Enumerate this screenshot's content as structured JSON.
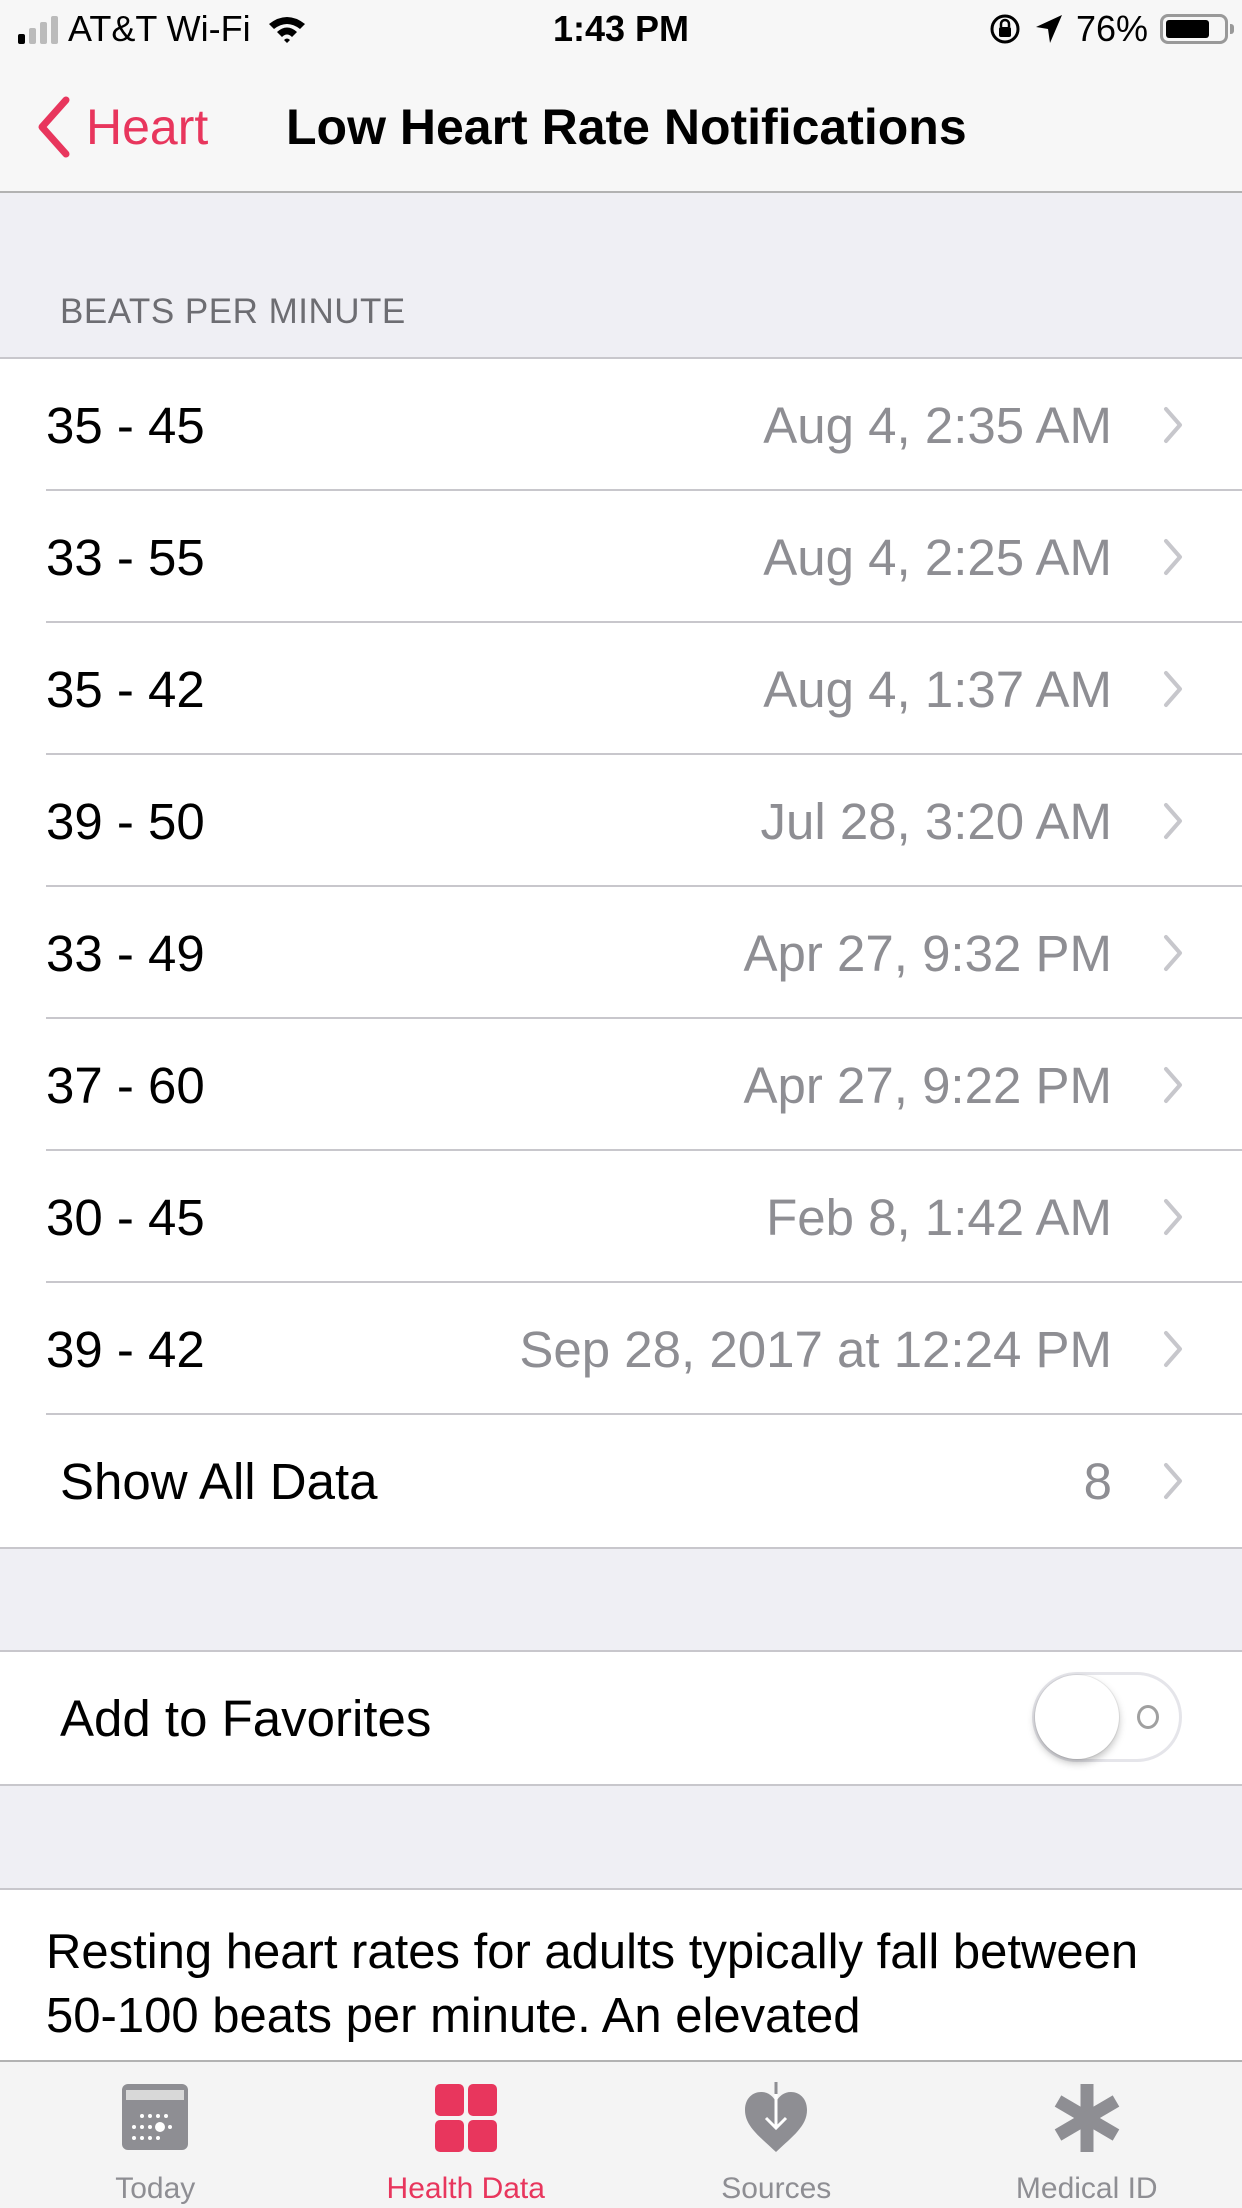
{
  "status_bar": {
    "carrier": "AT&T Wi-Fi",
    "time": "1:43 PM",
    "battery_percent": "76%",
    "battery_level": 0.76,
    "signal_bars_on": 1,
    "signal_bars_total": 4
  },
  "nav": {
    "back_label": "Heart",
    "title": "Low Heart Rate Notifications"
  },
  "section": {
    "header": "BEATS PER MINUTE",
    "rows": [
      {
        "range": "35 - 45",
        "date": "Aug 4, 2:35 AM"
      },
      {
        "range": "33 - 55",
        "date": "Aug 4, 2:25 AM"
      },
      {
        "range": "35 - 42",
        "date": "Aug 4, 1:37 AM"
      },
      {
        "range": "39 - 50",
        "date": "Jul 28, 3:20 AM"
      },
      {
        "range": "33 - 49",
        "date": "Apr 27, 9:32 PM"
      },
      {
        "range": "37 - 60",
        "date": "Apr 27, 9:22 PM"
      },
      {
        "range": "30 - 45",
        "date": "Feb 8, 1:42 AM"
      },
      {
        "range": "39 - 42",
        "date": "Sep 28, 2017 at 12:24 PM"
      }
    ],
    "show_all_label": "Show All Data",
    "show_all_count": "8"
  },
  "favorites": {
    "label": "Add to Favorites",
    "enabled": false
  },
  "description": "Resting heart rates for adults typically fall between 50-100 beats per minute. An elevated",
  "tabs": [
    {
      "label": "Today",
      "icon": "calendar-icon",
      "active": false
    },
    {
      "label": "Health Data",
      "icon": "health-data-grid-icon",
      "active": true
    },
    {
      "label": "Sources",
      "icon": "heart-download-icon",
      "active": false
    },
    {
      "label": "Medical ID",
      "icon": "asterisk-icon",
      "active": false
    }
  ],
  "colors": {
    "accent": "#e8365d",
    "secondary_text": "#8e8e93",
    "grouped_background": "#efeff4"
  }
}
